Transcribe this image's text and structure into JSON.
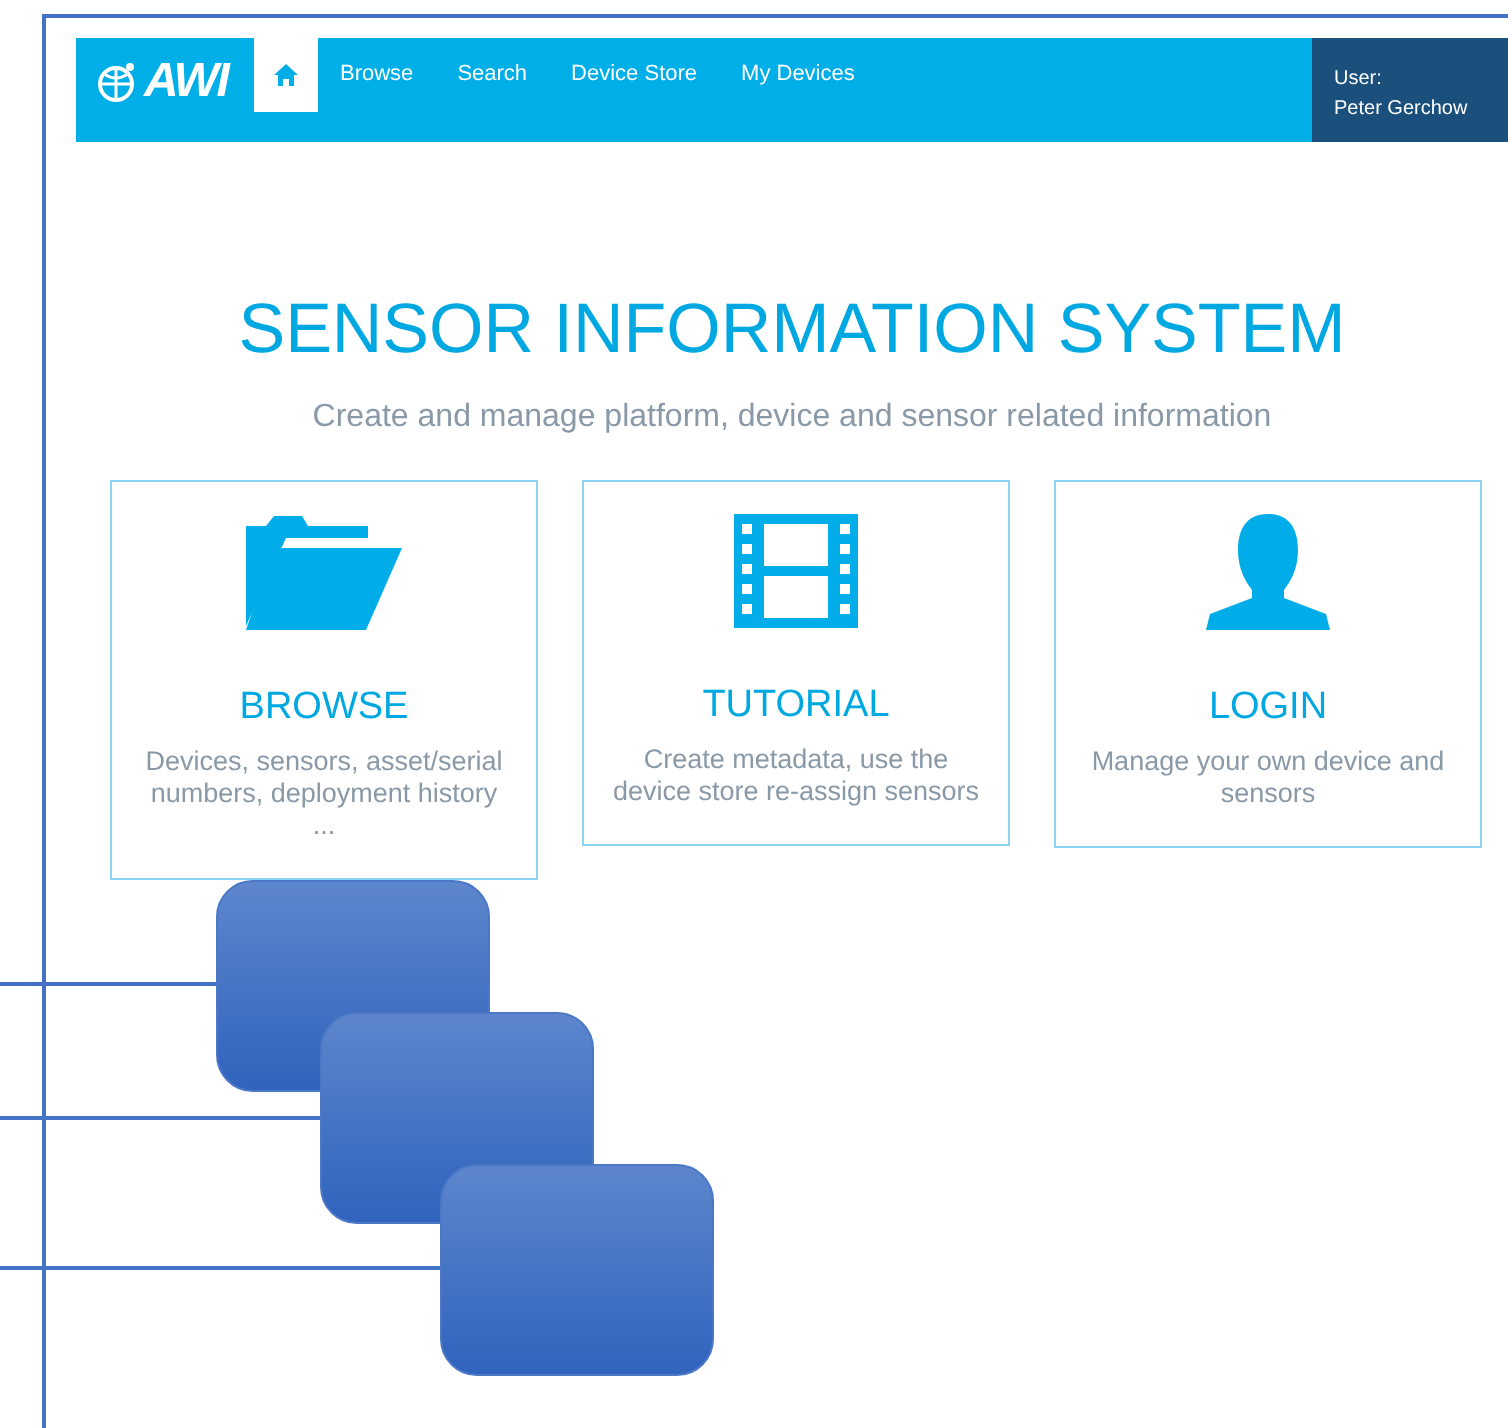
{
  "navbar": {
    "logo": "AWI",
    "items": [
      {
        "kind": "home",
        "selected": true
      },
      {
        "label": "Browse",
        "selected": false
      },
      {
        "label": "Search",
        "selected": false
      },
      {
        "label": "Device Store",
        "selected": false
      },
      {
        "label": "My Devices",
        "selected": false
      }
    ],
    "user": {
      "label": "User:",
      "name": "Peter Gerchow"
    }
  },
  "hero": {
    "title": "SENSOR INFORMATION SYSTEM",
    "subtitle": "Create and manage platform, device and sensor related information"
  },
  "cards": [
    {
      "kind": "folder",
      "title": "BROWSE",
      "text": "Devices, sensors, asset/serial numbers, deployment history ..."
    },
    {
      "kind": "film",
      "title": "TUTORIAL",
      "text": "Create metadata, use the device store re-assign sensors"
    },
    {
      "kind": "person",
      "title": "LOGIN",
      "text": "Manage your own device and sensors"
    }
  ]
}
